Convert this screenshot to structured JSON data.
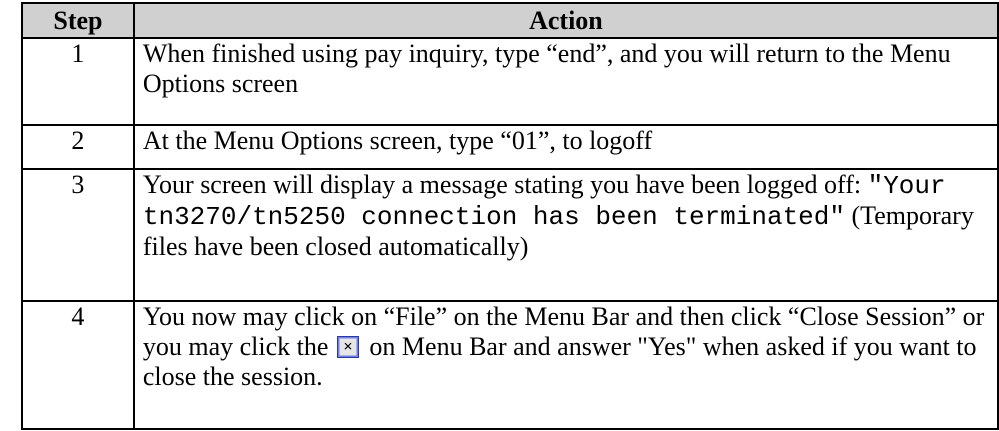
{
  "table": {
    "headers": {
      "step": "Step",
      "action": "Action"
    },
    "rows": [
      {
        "step": "1",
        "action": "When finished using pay inquiry, type “end”, and you will return to the Menu Options screen"
      },
      {
        "step": "2",
        "action": "At the Menu Options screen, type “01”, to logoff"
      },
      {
        "step": "3",
        "action_before": "Your screen will display a message stating you have been logged off: ",
        "action_mono": "\"Your tn3270/tn5250 connection has been terminated\"",
        "action_after": " (Temporary files have been closed automatically)"
      },
      {
        "step": "4",
        "action_before": "You now may click on “File” on the Menu Bar and then click “Close Session” or you may click the ",
        "icon": "close-x-icon",
        "action_after": "  on Menu Bar and answer \"Yes\" when asked if you want to close the session."
      }
    ]
  }
}
